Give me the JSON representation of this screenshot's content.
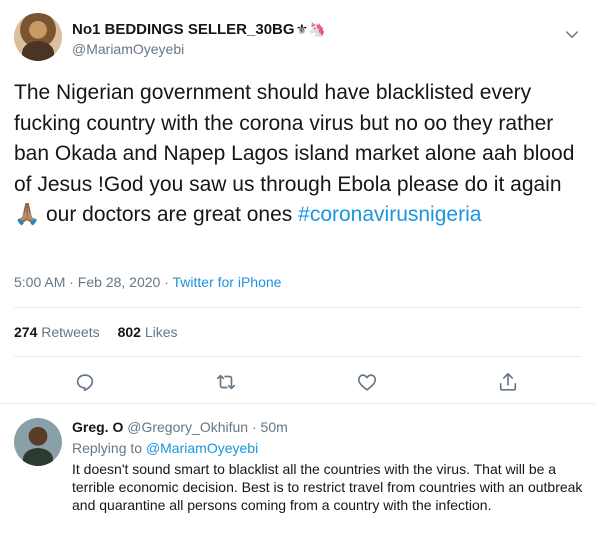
{
  "tweet": {
    "author_name": "No1 BEDDINGS SELLER_30BG",
    "author_emoji": "⚜🦄",
    "author_handle": "@MariamOyeyebi",
    "text": "The Nigerian government should have blacklisted every fucking country with the corona virus but no oo they rather ban Okada and Napep Lagos island market alone aah blood of Jesus !God you saw us through Ebola please do it again 🙏🏽 our doctors are great ones",
    "hashtag": "#coronavirusnigeria",
    "time": "5:00 AM · Feb 28, 2020 · ",
    "source": "Twitter for iPhone",
    "retweets_count": "274",
    "retweets_label": "Retweets",
    "likes_count": "802",
    "likes_label": "Likes"
  },
  "actions": {
    "reply_icon": "reply-icon",
    "retweet_icon": "retweet-icon",
    "like_icon": "heart-icon",
    "share_icon": "share-icon"
  },
  "reply": {
    "name": "Greg. O",
    "handle": "@Gregory_Okhifun",
    "separator": " · ",
    "time": "50m",
    "replying_prefix": "Replying to ",
    "replying_to": "@MariamOyeyebi",
    "text": "It doesn't sound smart to blacklist all the countries with the virus. That will be a terrible economic decision. Best is to restrict travel from countries with an outbreak and quarantine all persons coming from a country with the infection."
  },
  "colors": {
    "accent": "#1b95e0",
    "secondary_text": "#657786",
    "divider": "#e6ecf0"
  }
}
